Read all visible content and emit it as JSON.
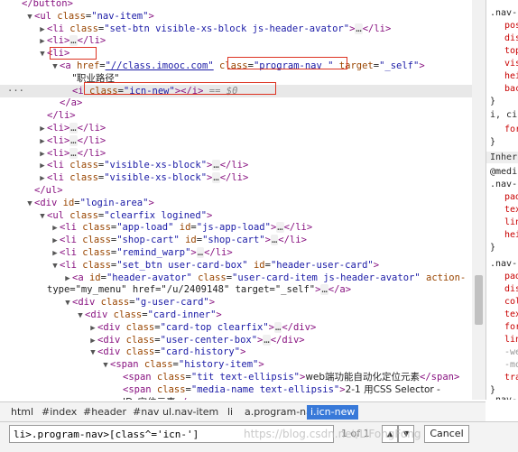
{
  "tree": [
    {
      "text": "</button>"
    },
    {
      "text": "<ul class=\"nav-item\">"
    },
    {
      "text": "<li class=\"set-btn visible-xs-block js-header-avator\">…</li>"
    },
    {
      "text": "<li>…</li>"
    },
    {
      "text": "<li>"
    },
    {
      "text": "<a href=\"//class.imooc.com\" class=\"program-nav \" target=\"_self\">"
    },
    {
      "text": "\"职业路径\""
    },
    {
      "text": "<i class=\"icn-new\"></i> == $0"
    },
    {
      "text": "</a>"
    },
    {
      "text": "</li>"
    },
    {
      "text": "<li>…</li>"
    },
    {
      "text": "<li>…</li>"
    },
    {
      "text": "<li>…</li>"
    },
    {
      "text": "<li class=\"visible-xs-block\">…</li>"
    },
    {
      "text": "<li class=\"visible-xs-block\">…</li>"
    },
    {
      "text": "</ul>"
    },
    {
      "text": "<div id=\"login-area\">"
    },
    {
      "text": "<ul class=\"clearfix logined\">"
    },
    {
      "text": "<li class=\"app-load\" id=\"js-app-load\">…</li>"
    },
    {
      "text": "<li class=\"shop-cart\" id=\"shop-cart\">…</li>"
    },
    {
      "text": "<li class=\"remind_warp\">…</li>"
    },
    {
      "text": "<li class=\"set_btn user-card-box\" id=\"header-user-card\">"
    },
    {
      "text": "<a id=\"header-avator\" class=\"user-card-item js-header-avator\" action-"
    },
    {
      "text": "type=\"my_menu\" href=\"/u/2409148\" target=\"_self\">…</a>"
    },
    {
      "text": "<div class=\"g-user-card\">"
    },
    {
      "text": "<div class=\"card-inner\">"
    },
    {
      "text": "<div class=\"card-top clearfix\">…</div>"
    },
    {
      "text": "<div class=\"user-center-box\">…</div>"
    },
    {
      "text": "<div class=\"card-history\">"
    },
    {
      "text": "<span class=\"history-item\">"
    },
    {
      "text": "<span class=\"tit text-ellipsis\">web端功能自动化定位元素</span>"
    },
    {
      "text": "<span class=\"media-name text-ellipsis\">2-1 用CSS Selector -"
    },
    {
      "text": "IDs定位元素</span>"
    }
  ],
  "sidebar": [
    ".nav-",
    "pos",
    "dis",
    "top",
    "vis",
    "hei",
    "bac",
    "}",
    "i, ci",
    "for",
    "}",
    "Inherit",
    "@medi",
    ".nav-",
    "pad",
    "tex",
    "lin",
    "hei",
    "}",
    ".nav-",
    "pad",
    "dis",
    "col",
    "tex",
    "for",
    "lin",
    "-we",
    "-mo",
    "tra",
    "}",
    ".nav-",
    "pad",
    "Fong"
  ],
  "breadcrumbs": [
    "html",
    "#index",
    "#header",
    "#nav",
    "ul.nav-item",
    "li",
    "a.program-nav",
    "i.icn-new"
  ],
  "find": {
    "query": "li>.program-nav>[class^='icn-']",
    "count": "1 of 1",
    "up": "▲",
    "down": "▼",
    "cancel": "Cancel"
  },
  "watermark": "https://blog.csdn.net/LiFongFong",
  "colors": {
    "tag": "#881280",
    "attr": "#994500",
    "value": "#1a1aa6",
    "highlight": "#e8e8e8",
    "active_crumb": "#3879d9",
    "box": "#dd3322"
  }
}
